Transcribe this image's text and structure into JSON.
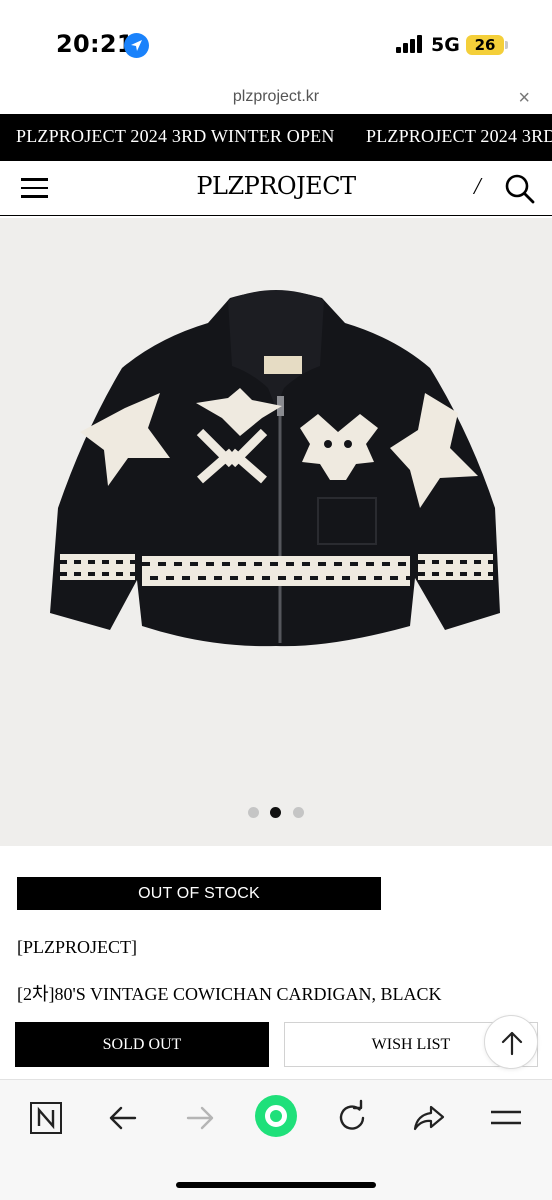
{
  "status_bar": {
    "time": "20:21",
    "network": "5G",
    "battery": "26"
  },
  "browser": {
    "url": "plzproject.kr",
    "close_symbol": "×"
  },
  "announcement": {
    "text": "PLZPROJECT 2024 3RD WINTER OPEN",
    "text_repeat": "PLZPROJECT 2024 3RD"
  },
  "header": {
    "logo": "PLZPROJECT",
    "slash": "/",
    "menu_icon": "hamburger-icon",
    "search_icon": "search-icon"
  },
  "gallery": {
    "image_count": 3,
    "active_index": 1
  },
  "product": {
    "stock_status": "OUT OF STOCK",
    "brand": "[PLZPROJECT]",
    "name": "[2차]80'S VINTAGE COWICHAN CARDIGAN, BLACK",
    "sold_out_label": "SOLD OUT",
    "wish_list_label": "WISH LIST"
  },
  "toolbar": {
    "icons": [
      "naver-icon",
      "back-arrow-icon",
      "forward-arrow-icon",
      "green-home-icon",
      "reload-icon",
      "share-icon",
      "menu-icon"
    ]
  },
  "colors": {
    "accent_green": "#1fe07a",
    "location_blue": "#1a82fb",
    "battery_yellow": "#f4cf3a"
  }
}
